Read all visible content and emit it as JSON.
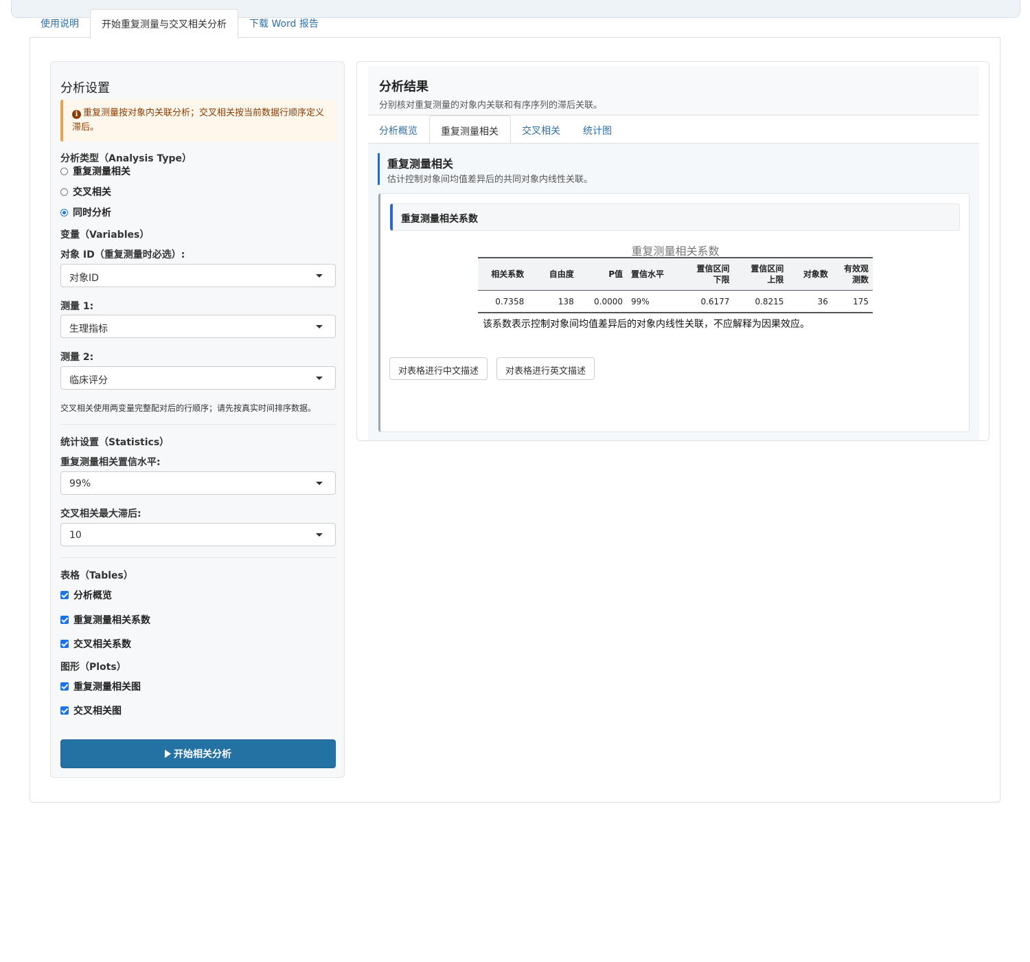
{
  "main_tabs": [
    "使用说明",
    "开始重复测量与交叉相关分析",
    "下载 Word 报告"
  ],
  "sidebar": {
    "title": "分析设置",
    "alert": "重复测量按对象内关联分析；交叉相关按当前数据行顺序定义滞后。",
    "analysis_type_label": "分析类型（Analysis Type）",
    "analysis_options": [
      "重复测量相关",
      "交叉相关",
      "同时分析"
    ],
    "variables_label": "变量（Variables）",
    "id_label": "对象 ID（重复测量时必选）:",
    "id_value": "对象ID",
    "m1_label": "测量 1:",
    "m1_value": "生理指标",
    "m2_label": "测量 2:",
    "m2_value": "临床评分",
    "help_text": "交叉相关使用两变量完整配对后的行顺序；请先按真实时间排序数据。",
    "stats_label": "统计设置（Statistics）",
    "conf_label": "重复测量相关置信水平:",
    "conf_value": "99%",
    "lag_label": "交叉相关最大滞后:",
    "lag_value": "10",
    "tables_label": "表格（Tables）",
    "tables": [
      "分析概览",
      "重复测量相关系数",
      "交叉相关系数"
    ],
    "plots_label": "图形（Plots）",
    "plots": [
      "重复测量相关图",
      "交叉相关图"
    ],
    "run_button": "开始相关分析"
  },
  "results": {
    "title": "分析结果",
    "subtitle": "分别核对重复测量的对象内关联和有序序列的滞后关联。",
    "tabs": [
      "分析概览",
      "重复测量相关",
      "交叉相关",
      "统计图"
    ],
    "section_title": "重复测量相关",
    "section_sub": "估计控制对象间均值差异后的共同对象内线性关联。",
    "card_title": "重复测量相关系数",
    "table_caption": "重复测量相关系数",
    "table_headers": [
      "相关系数",
      "自由度",
      "P值",
      "置信水平",
      "置信区间下限",
      "置信区间上限",
      "对象数",
      "有效观测数"
    ],
    "table_row": [
      "0.7358",
      "138",
      "0.0000",
      "99%",
      "0.6177",
      "0.8215",
      "36",
      "175"
    ],
    "note": "该系数表示控制对象间均值差异后的对象内线性关联，不应解释为因果效应。",
    "btn_cn": "对表格进行中文描述",
    "btn_en": "对表格进行英文描述"
  }
}
